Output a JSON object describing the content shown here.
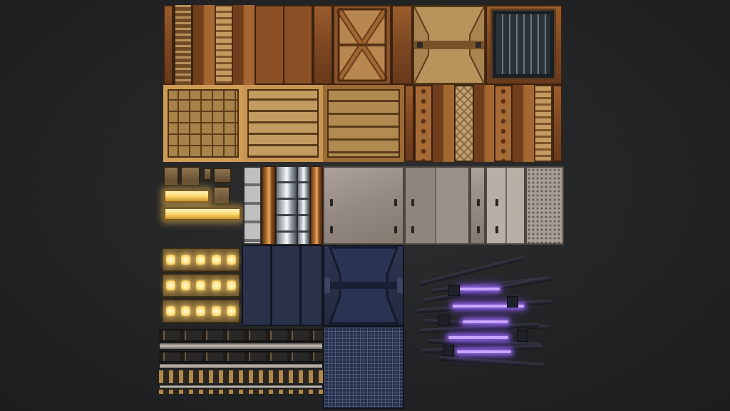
{
  "image": {
    "description_type": "texture atlas",
    "background_color": "#232425"
  },
  "palette": {
    "copper": "#8a4f25",
    "brass": "#b58c52",
    "steel_grey": "#a69d95",
    "navy_steel": "#2a3149",
    "warm_light": "#ffd86a",
    "purple_glow": "#a06eff"
  }
}
